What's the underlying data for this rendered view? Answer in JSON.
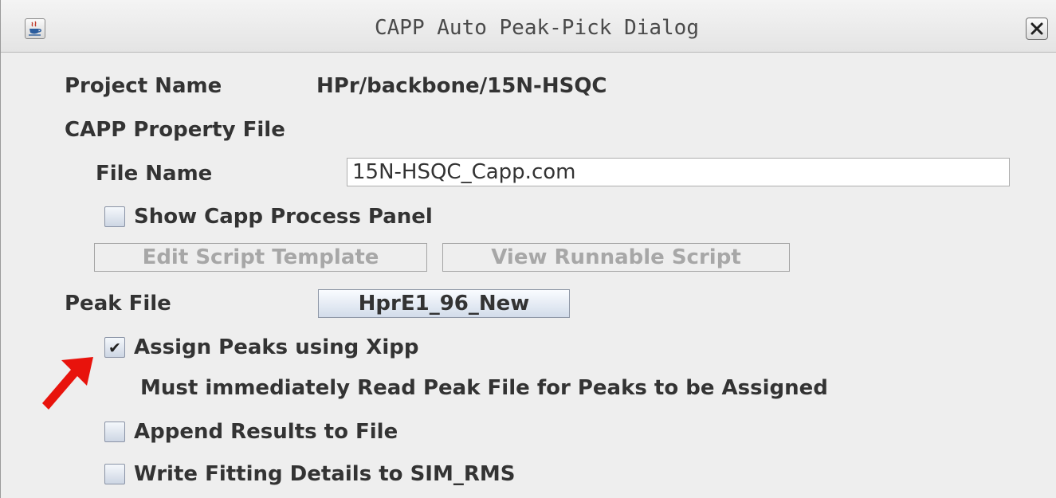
{
  "window": {
    "title": "CAPP Auto Peak-Pick Dialog",
    "icon": "java-cup-icon",
    "close_icon": "close-x-icon"
  },
  "project": {
    "label": "Project Name",
    "value": "HPr/backbone/15N-HSQC"
  },
  "property_file": {
    "section_label": "CAPP Property File",
    "file_name_label": "File Name",
    "file_name_value": "15N-HSQC_Capp.com",
    "show_panel_label": "Show Capp Process Panel",
    "show_panel_checked": false,
    "edit_button_label": "Edit Script Template",
    "view_button_label": "View Runnable Script"
  },
  "peak_file": {
    "label": "Peak File",
    "button_label": "HprE1_96_New"
  },
  "options": {
    "assign_label": "Assign Peaks using Xipp",
    "assign_checked": true,
    "assign_note": "Must immediately Read Peak File for Peaks to be Assigned",
    "append_label": "Append Results to File",
    "append_checked": false,
    "write_label": "Write Fitting Details to SIM_RMS",
    "write_checked": false
  },
  "annotation": {
    "arrow_icon": "red-arrow-icon",
    "arrow_color": "#e8130c"
  },
  "colors": {
    "background": "#eeeeee",
    "text": "#333333",
    "disabled_text": "#a7a7a7"
  }
}
